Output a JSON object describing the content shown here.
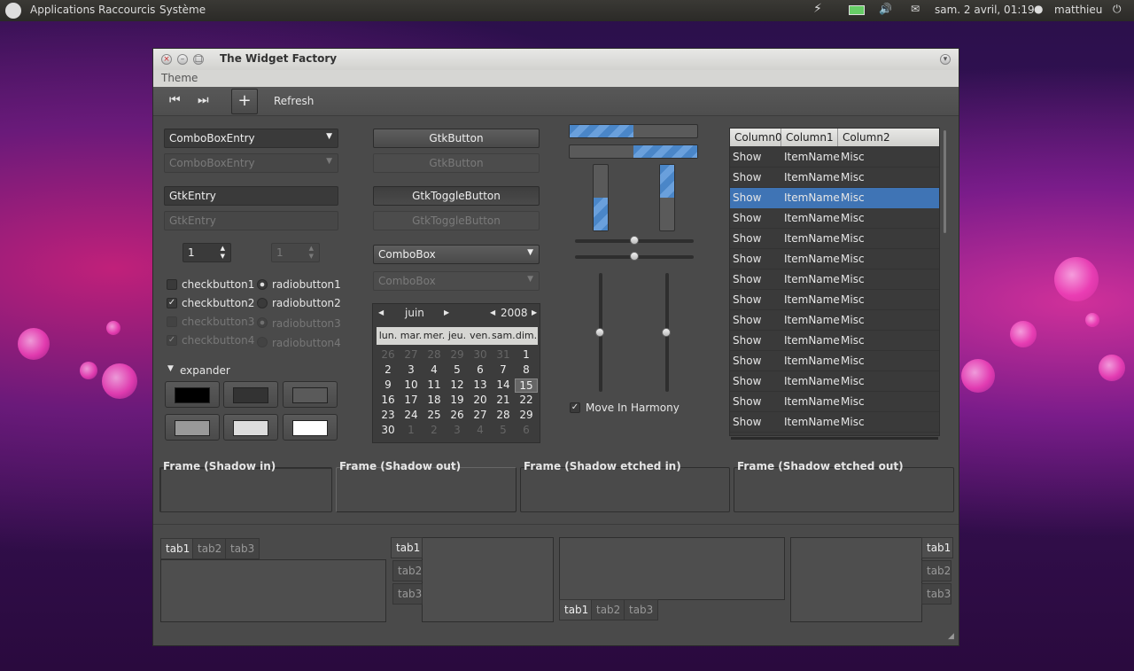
{
  "panel": {
    "menus": [
      "Applications",
      "Raccourcis",
      "Système"
    ],
    "datetime": "sam.  2 avril, 01:19",
    "user": "matthieu"
  },
  "window": {
    "title": "The Widget Factory",
    "menu": "Theme"
  },
  "toolbar": {
    "refresh": "Refresh"
  },
  "col1": {
    "combo1": "ComboBoxEntry",
    "combo2": "ComboBoxEntry",
    "entry1": "GtkEntry",
    "entry2": "GtkEntry",
    "spin1": "1",
    "spin2": "1",
    "check1": "checkbutton1",
    "check2": "checkbutton2",
    "check3": "checkbutton3",
    "check4": "checkbutton4",
    "radio1": "radiobutton1",
    "radio2": "radiobutton2",
    "radio3": "radiobutton3",
    "radio4": "radiobutton4",
    "expander": "expander"
  },
  "col2": {
    "btn1": "GtkButton",
    "btn2": "GtkButton",
    "tog1": "GtkToggleButton",
    "tog2": "GtkToggleButton",
    "combo1": "ComboBox",
    "combo2": "ComboBox"
  },
  "calendar": {
    "month": "juin",
    "year": "2008",
    "days": [
      "lun.",
      "mar.",
      "mer.",
      "jeu.",
      "ven.",
      "sam.",
      "dim."
    ],
    "rows": [
      [
        "26",
        "27",
        "28",
        "29",
        "30",
        "31",
        "1"
      ],
      [
        "2",
        "3",
        "4",
        "5",
        "6",
        "7",
        "8"
      ],
      [
        "9",
        "10",
        "11",
        "12",
        "13",
        "14",
        "15"
      ],
      [
        "16",
        "17",
        "18",
        "19",
        "20",
        "21",
        "22"
      ],
      [
        "23",
        "24",
        "25",
        "26",
        "27",
        "28",
        "29"
      ],
      [
        "30",
        "1",
        "2",
        "3",
        "4",
        "5",
        "6"
      ]
    ]
  },
  "progress": {
    "h1": 0.5,
    "h2": 0.5,
    "v1": 0.5,
    "v2": 0.5
  },
  "harmony": "Move In Harmony",
  "tree": {
    "columns": [
      "Column0",
      "Column1",
      "Column2"
    ],
    "row": [
      "Show",
      "ItemName",
      "Misc"
    ],
    "rows": 14,
    "selected": 2
  },
  "frames": [
    "Frame (Shadow in)",
    "Frame (Shadow out)",
    "Frame (Shadow etched in)",
    "Frame (Shadow etched out)"
  ],
  "tabs": [
    "tab1",
    "tab2",
    "tab3"
  ]
}
